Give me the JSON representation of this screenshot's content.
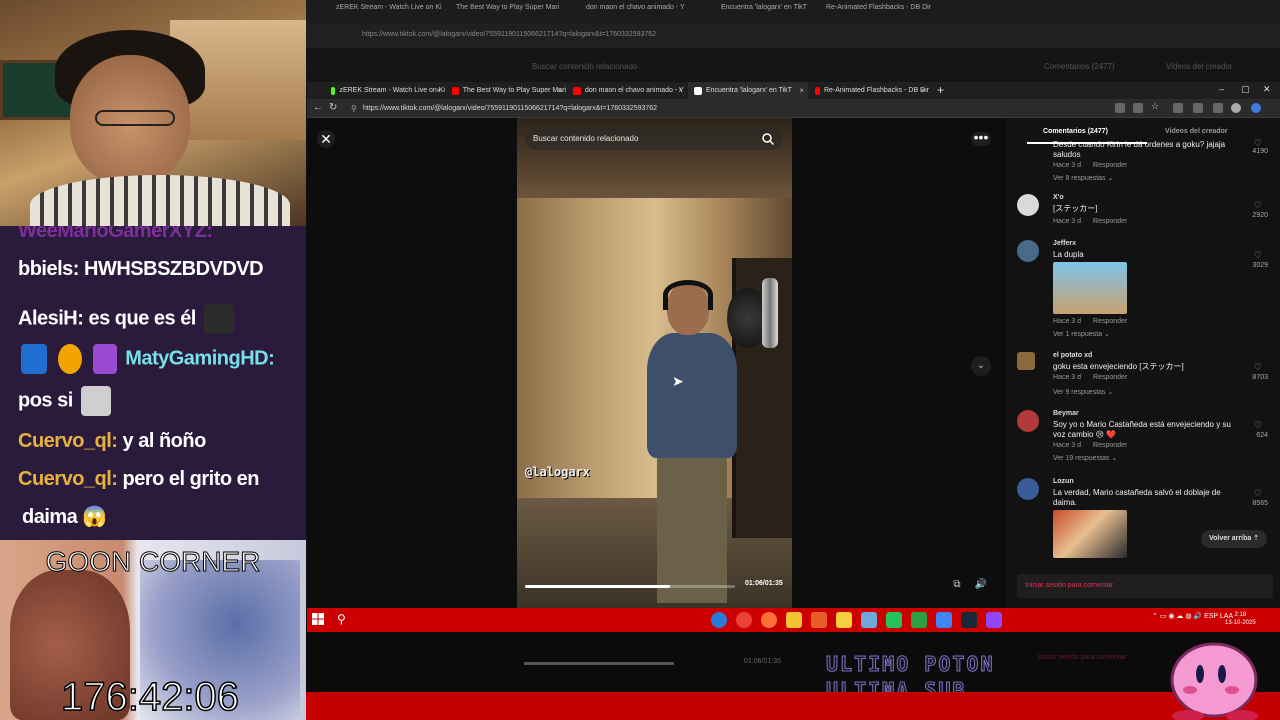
{
  "overlay": {
    "chat": [
      {
        "user": "WeeMarioGamerXYZ:",
        "message": "",
        "user_color": "#b43bd6"
      },
      {
        "user": "bbiels:",
        "message": "HWHSBSZBDVDVD",
        "user_color": "#ffffff"
      },
      {
        "user": "AlesiH:",
        "message": "es que es él",
        "user_color": "#ffffff"
      },
      {
        "user": "MatyGamingHD:",
        "message": "pos si",
        "user_color": "#78e0e8"
      },
      {
        "user": "Cuervo_ql:",
        "message": "y al ñoño",
        "user_color": "#e7b13c"
      },
      {
        "user": "Cuervo_ql:",
        "message": "pero el grito en",
        "user_color": "#e7b13c"
      },
      {
        "user": "",
        "message": "daima 😱",
        "user_color": "#ffffff"
      }
    ],
    "goon_title": "GOON CORNER",
    "goon_timer": "176:42:06",
    "bottom_banner": [
      "ULTIMO POTON",
      "ULTIMA SUB"
    ]
  },
  "background_screen": {
    "tabs": [
      "zEREK Stream - Watch Live on Ki",
      "The Best Way to Play Super Mari",
      "don maon el chavo animado - Y",
      "Encuentra 'lalogarx' en TikT",
      "Re-Animated Flashbacks - DB Dir"
    ],
    "url": "https://www.tiktok.com/@lalogarx/video/7559119011506621714?q=lalogarx&t=1760332593762",
    "header_left": "Buscar contenido relacionado",
    "header_right_1": "Comentarios (2477)",
    "header_right_2": "Videos del creador",
    "progress_label": "01:06/01:35",
    "login_label": "Iniciar sesión para comentar"
  },
  "browser": {
    "tabs": [
      {
        "title": "zEREK Stream - Watch Live on Ki",
        "color": "#53fc18"
      },
      {
        "title": "The Best Way to Play Super Mari",
        "color": "#ff0000"
      },
      {
        "title": "don maon el chavo animado - Y",
        "color": "#ff0000"
      },
      {
        "title": "Encuentra 'lalogarx' en TikT",
        "color": "#ffffff"
      },
      {
        "title": "Re-Animated Flashbacks - DB Dir",
        "color": "#ff0000"
      }
    ],
    "url": "https://www.tiktok.com/@lalogarx/video/7559119011506621714?q=lalogarx&t=1760332593762"
  },
  "video": {
    "search_placeholder": "Buscar contenido relacionado",
    "watermark": "@lalogarx",
    "time": "01:06/01:35",
    "progress": 0.69
  },
  "comments_panel": {
    "tab_comments": "Comentarios (2477)",
    "tab_creator": "Videos del creador",
    "comments": [
      {
        "name": "",
        "text": "Desde cuando Kirin le dá ordenes a goku? jajaja saludos",
        "time": "Hace 3 d",
        "reply": "Responder",
        "replies": "Ver 8 respuestas",
        "likes": "4190",
        "avatar_color": "#555555"
      },
      {
        "name": "X'o",
        "text": "[ステッカー]",
        "time": "Hace 3 d",
        "reply": "Responder",
        "replies": "",
        "likes": "2920",
        "avatar_color": "#d9d9d9"
      },
      {
        "name": "Jefferx",
        "text": "La dupla",
        "time": "Hace 3 d",
        "reply": "Responder",
        "replies": "Ver 1 respuesta",
        "likes": "3029",
        "avatar_color": "#4a6a8c"
      },
      {
        "name": "el potato xd",
        "text": "goku esta envejeciendo [ステッカー]",
        "time": "Hace 3 d",
        "reply": "Responder",
        "replies": "Ver 9 respuestas",
        "likes": "8703",
        "avatar_color": "#8a6a3c"
      },
      {
        "name": "Beymar",
        "text": "Soy yo o Mario Castañeda está envejeciendo y su voz cambio 😢 ❤️",
        "time": "Hace 3 d",
        "reply": "Responder",
        "replies": "Ver 19 respuestas",
        "likes": "624",
        "avatar_color": "#b33a3a"
      },
      {
        "name": "Lozun",
        "text": "La verdad, Mario castañeda salvó el doblaje de daima.",
        "time": "",
        "reply": "",
        "replies": "",
        "likes": "8565",
        "avatar_color": "#3a5c9a"
      }
    ],
    "back_to_top": "Volver arriba",
    "login_prompt": "Iniciar sesión para comentar"
  },
  "taskbar": {
    "tray_lang": "ESP LAA",
    "time": "2:18",
    "date": "13-10-2025"
  }
}
